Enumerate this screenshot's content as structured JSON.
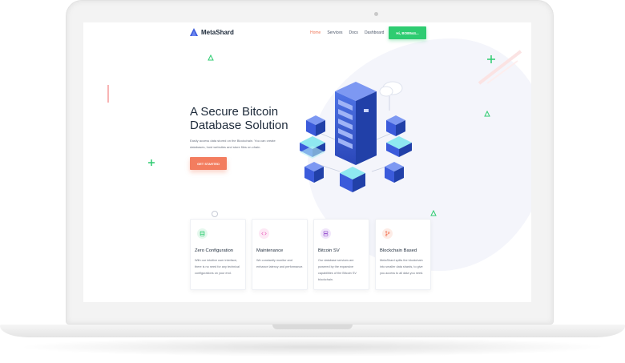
{
  "brand": {
    "name": "MetaShard"
  },
  "nav": {
    "items": [
      "Home",
      "Services",
      "Docs",
      "Dashboard"
    ],
    "active": "Home",
    "account_button": "Hi, BOB544..."
  },
  "hero": {
    "title_line1": "A Secure Bitcoin",
    "title_line2": "Database Solution",
    "subtitle_line1": "Easily access data stored on the Blockchain. You can create",
    "subtitle_line2": "databases, host websites and store files on-chain.",
    "cta_label": "GET STARTED"
  },
  "features": [
    {
      "icon": "database-icon",
      "title": "Zero Configuration",
      "text": "With our intuitive user interface, there is no need for any technical configurations on your end.",
      "accent": "#2ecc71",
      "bg": "#e6f8ee"
    },
    {
      "icon": "code-icon",
      "title": "Maintenance",
      "text": "We constantly monitor and enhance latency and performance.",
      "accent": "#e86bc0",
      "bg": "#fde8f5"
    },
    {
      "icon": "server-icon",
      "title": "Bitcoin SV",
      "text": "Our database services are powered by the expansive capabilities of the Bitcoin SV blockchain.",
      "accent": "#9b59d0",
      "bg": "#f1e6fb"
    },
    {
      "icon": "git-branch-icon",
      "title": "Blockchain Based",
      "text": "MetaShard splits the blockchain into smaller data shards, to give you access to all data you need.",
      "accent": "#f37d5f",
      "bg": "#fdece6"
    }
  ],
  "colors": {
    "primary": "#2ecc71",
    "accent": "#f37d5f",
    "text": "#1d2a3a",
    "server": "#3b5bdb"
  }
}
